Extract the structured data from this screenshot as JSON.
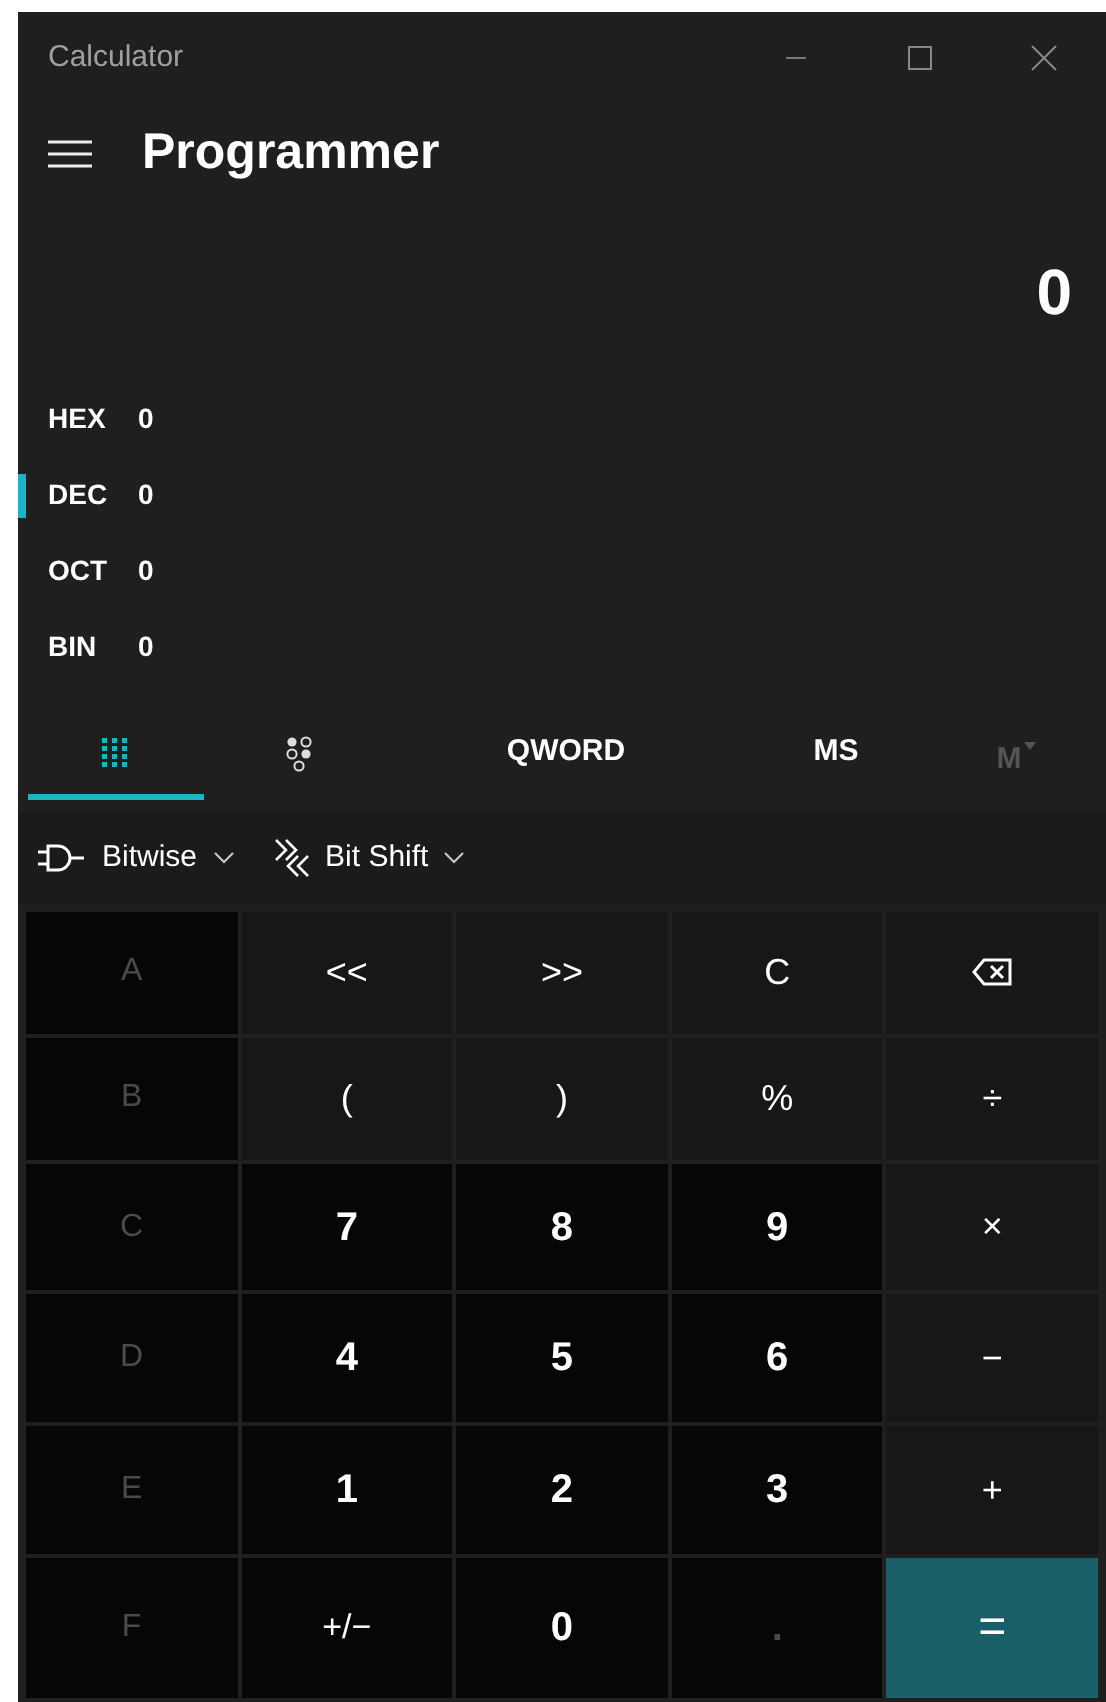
{
  "window": {
    "title": "Calculator"
  },
  "header": {
    "mode": "Programmer"
  },
  "display": {
    "value": "0"
  },
  "radix": [
    {
      "label": "HEX",
      "value": "0",
      "selected": false
    },
    {
      "label": "DEC",
      "value": "0",
      "selected": true
    },
    {
      "label": "OCT",
      "value": "0",
      "selected": false
    },
    {
      "label": "BIN",
      "value": "0",
      "selected": false
    }
  ],
  "tabs": [
    {
      "kind": "keypad",
      "selected": true,
      "disabled": false
    },
    {
      "kind": "bits",
      "selected": false,
      "disabled": false
    },
    {
      "kind": "text",
      "label": "QWORD",
      "selected": false,
      "disabled": false
    },
    {
      "kind": "text",
      "label": "MS",
      "selected": false,
      "disabled": false
    },
    {
      "kind": "memory",
      "label": "M",
      "selected": false,
      "disabled": true
    }
  ],
  "dropdowns": [
    {
      "kind": "gate",
      "label": "Bitwise"
    },
    {
      "kind": "shift",
      "label": "Bit Shift"
    }
  ],
  "keys": [
    {
      "kind": "hex",
      "label": "A",
      "disabled": true
    },
    {
      "kind": "op",
      "label": "<<",
      "disabled": false
    },
    {
      "kind": "op",
      "label": ">>",
      "disabled": false
    },
    {
      "kind": "op",
      "label": "C",
      "disabled": false
    },
    {
      "kind": "backspace",
      "disabled": false
    },
    {
      "kind": "hex",
      "label": "B",
      "disabled": true
    },
    {
      "kind": "op",
      "label": "(",
      "disabled": false
    },
    {
      "kind": "op",
      "label": ")",
      "disabled": false
    },
    {
      "kind": "op",
      "label": "%",
      "disabled": false
    },
    {
      "kind": "op",
      "label": "÷",
      "disabled": false
    },
    {
      "kind": "hex",
      "label": "C",
      "disabled": true
    },
    {
      "kind": "digit",
      "label": "7",
      "disabled": false
    },
    {
      "kind": "digit",
      "label": "8",
      "disabled": false
    },
    {
      "kind": "digit",
      "label": "9",
      "disabled": false
    },
    {
      "kind": "op",
      "label": "×",
      "disabled": false
    },
    {
      "kind": "hex",
      "label": "D",
      "disabled": true
    },
    {
      "kind": "digit",
      "label": "4",
      "disabled": false
    },
    {
      "kind": "digit",
      "label": "5",
      "disabled": false
    },
    {
      "kind": "digit",
      "label": "6",
      "disabled": false
    },
    {
      "kind": "op",
      "label": "−",
      "disabled": false
    },
    {
      "kind": "hex",
      "label": "E",
      "disabled": true
    },
    {
      "kind": "digit",
      "label": "1",
      "disabled": false
    },
    {
      "kind": "digit",
      "label": "2",
      "disabled": false
    },
    {
      "kind": "digit",
      "label": "3",
      "disabled": false
    },
    {
      "kind": "op",
      "label": "+",
      "disabled": false
    },
    {
      "kind": "hex",
      "label": "F",
      "disabled": true
    },
    {
      "kind": "digitop",
      "label": "+/−",
      "disabled": false
    },
    {
      "kind": "digit",
      "label": "0",
      "disabled": false
    },
    {
      "kind": "digit",
      "label": ".",
      "disabled": true
    },
    {
      "kind": "equals",
      "label": "=",
      "disabled": false
    }
  ]
}
